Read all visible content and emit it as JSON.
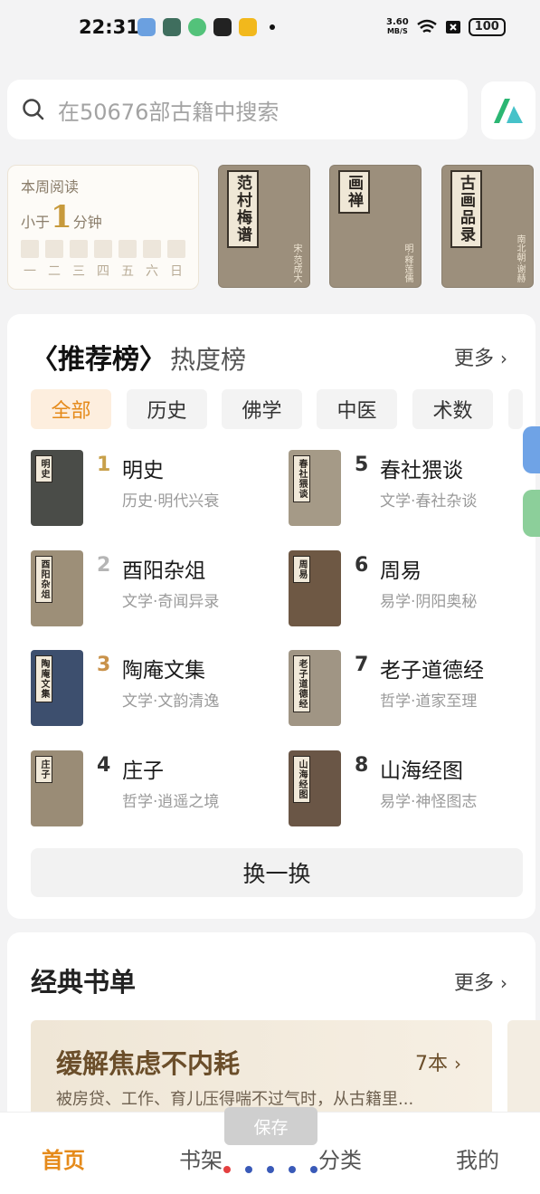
{
  "status_bar": {
    "time": "22:31",
    "net_speed": "3.60",
    "net_unit": "MB/S",
    "battery": "100",
    "icons": [
      "app-icon-1",
      "app-icon-2",
      "app-icon-3",
      "app-icon-4",
      "app-icon-5",
      "wifi-icon",
      "sim-icon"
    ]
  },
  "search": {
    "placeholder": "在50676部古籍中搜索"
  },
  "weekly": {
    "title": "本周阅读",
    "prefix": "小于",
    "number": "1",
    "suffix": "分钟",
    "days": [
      "一",
      "二",
      "三",
      "四",
      "五",
      "六",
      "日"
    ]
  },
  "recent_books": [
    {
      "title": "范村梅谱",
      "author": "宋·范成大"
    },
    {
      "title": "画禅",
      "author": "明·释莲儒"
    },
    {
      "title": "古画品录",
      "author": "南北朝·谢赫"
    }
  ],
  "rank": {
    "tab_recommend": "〈推荐榜〉",
    "tab_hot": "热度榜",
    "more": "更多",
    "categories": [
      "全部",
      "历史",
      "佛学",
      "中医",
      "术数"
    ],
    "books": [
      {
        "rank": "1",
        "title": "明史",
        "sub": "历史·明代兴衰",
        "cover_label": "明史",
        "cover_color": "#4a4c48",
        "rank_color": "#c8a04a"
      },
      {
        "rank": "2",
        "title": "酉阳杂俎",
        "sub": "文学·奇闻异录",
        "cover_label": "酉阳杂俎",
        "cover_color": "#9d8f78",
        "rank_color": "#b5b5b5"
      },
      {
        "rank": "3",
        "title": "陶庵文集",
        "sub": "文学·文韵清逸",
        "cover_label": "陶庵文集",
        "cover_color": "#3d4f6e",
        "rank_color": "#c9924a"
      },
      {
        "rank": "4",
        "title": "庄子",
        "sub": "哲学·逍遥之境",
        "cover_label": "庄子",
        "cover_color": "#9a8c76",
        "rank_color": "#333333"
      },
      {
        "rank": "5",
        "title": "春社猥谈",
        "sub": "文学·春社杂谈",
        "cover_label": "春社猥谈",
        "cover_color": "#a59a87",
        "rank_color": "#333333"
      },
      {
        "rank": "6",
        "title": "周易",
        "sub": "易学·阴阳奥秘",
        "cover_label": "周易",
        "cover_color": "#6e5844",
        "rank_color": "#333333"
      },
      {
        "rank": "7",
        "title": "老子道德经",
        "sub": "哲学·道家至理",
        "cover_label": "老子道德经",
        "cover_color": "#a09584",
        "rank_color": "#333333"
      },
      {
        "rank": "8",
        "title": "山海经图",
        "sub": "易学·神怪图志",
        "cover_label": "山海经图",
        "cover_color": "#6a5646",
        "rank_color": "#333333"
      }
    ],
    "swap_label": "换一换"
  },
  "classic": {
    "title": "经典书单",
    "more": "更多",
    "list_title": "缓解焦虑不内耗",
    "list_count": "7本",
    "list_desc": "被房贷、工作、育儿压得喘不过气时，从古籍里..."
  },
  "toast": "保存",
  "nav": {
    "home": "首页",
    "shelf": "书架",
    "category": "分类",
    "mine": "我的"
  },
  "colors": {
    "accent": "#e58a1a",
    "gold": "#c79a3c"
  }
}
